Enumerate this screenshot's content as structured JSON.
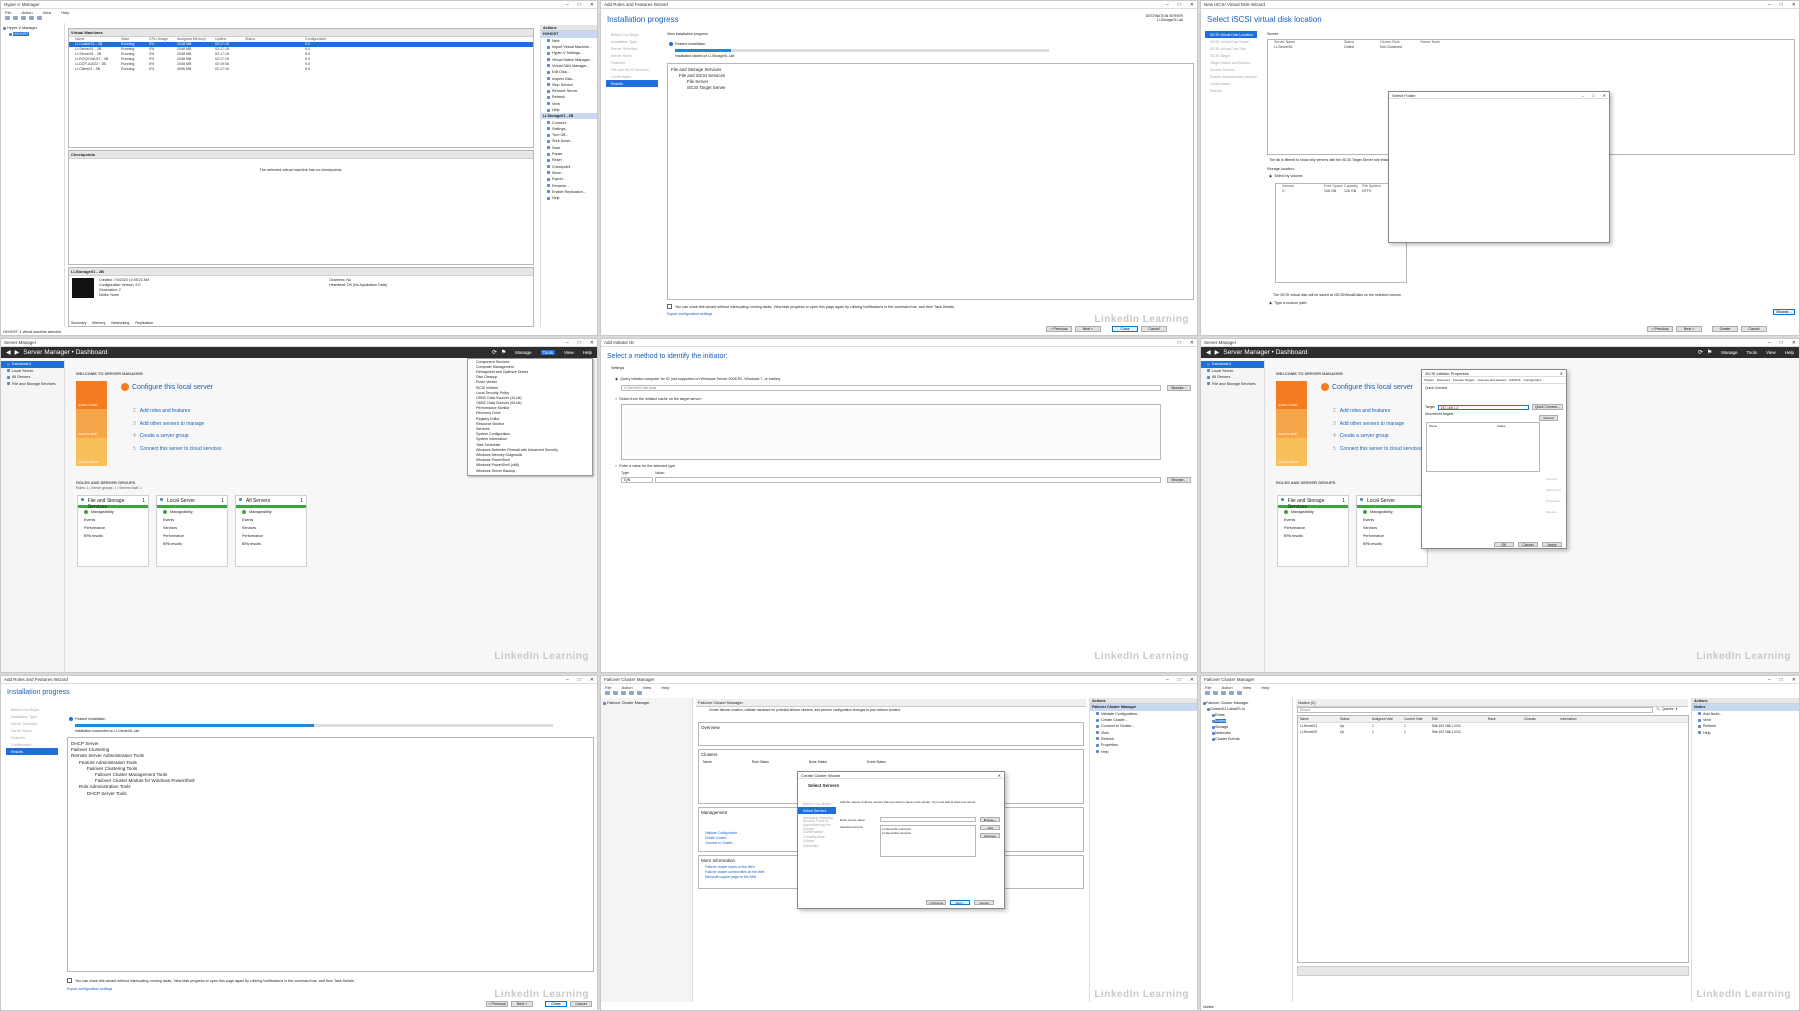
{
  "p1": {
    "title": "Hyper-V Manager",
    "menu": [
      "File",
      "Action",
      "View",
      "Help"
    ],
    "tree": [
      "Hyper-V Manager",
      "HVHOST"
    ],
    "vm_header": "Virtual Machines",
    "vm_columns": [
      "Name",
      "State",
      "CPU Usage",
      "Assigned Memory",
      "Uptime",
      "Status",
      "Configuration"
    ],
    "vms": [
      [
        "LI-Cluster01 - 2B",
        "Running",
        "0%",
        "2048 MB",
        "02:17:19",
        "",
        "9.0"
      ],
      [
        "LI-Server01 - 2B",
        "Running",
        "0%",
        "2048 MB",
        "02:17:15",
        "",
        "9.0"
      ],
      [
        "LI-Server01 - 2B",
        "Running",
        "0%",
        "2048 MB",
        "02:17:15",
        "",
        "9.0"
      ],
      [
        "LI-ROCKVAULT - 3B",
        "Running",
        "0%",
        "2048 MB",
        "02:17:19",
        "",
        "9.0"
      ],
      [
        "LI-DCP-A2022 - 2B",
        "Running",
        "0%",
        "2048 MB",
        "02:19:06",
        "",
        "9.0"
      ],
      [
        "LI-Client01 - 3B",
        "Running",
        "0%",
        "4096 MB",
        "02:17:15",
        "",
        "9.0"
      ]
    ],
    "checkpoints_header": "Checkpoints",
    "no_checkpoints": "The selected virtual machine has no checkpoints.",
    "detail_header": "LI-Storage01 - 2B",
    "details": [
      [
        "Created:",
        "7/4/2024 10:05:22 AM"
      ],
      [
        "Configuration Version:",
        "9.0"
      ],
      [
        "Generation:",
        "2"
      ],
      [
        "Notes:",
        "None"
      ]
    ],
    "details_right": [
      [
        "Clustered:",
        "No"
      ],
      [
        "Heartbeat:",
        "OK (No Application Data)"
      ]
    ],
    "detail_tabs": [
      "Summary",
      "Memory",
      "Networking",
      "Replication"
    ],
    "status": "HVHOST: 1 virtual machine selected.",
    "actions_header": "Actions",
    "actions_host": "HVHOST",
    "actions": [
      "New",
      "Import Virtual Machine...",
      "Hyper-V Settings...",
      "Virtual Switch Manager...",
      "Virtual SAN Manager...",
      "Edit Disk...",
      "Inspect Disk...",
      "Stop Service",
      "Remove Server",
      "Refresh",
      "View",
      "Help"
    ],
    "actions_vm": "LI-Storage01 - 2B",
    "actions2": [
      "Connect...",
      "Settings...",
      "Turn Off...",
      "Shut Down...",
      "Save",
      "Pause",
      "Reset",
      "Checkpoint",
      "Move...",
      "Export...",
      "Rename...",
      "Enable Replication...",
      "Help"
    ]
  },
  "p2": {
    "title": "Add Roles and Features Wizard",
    "heading": "Installation progress",
    "dest": "DESTINATION SERVER\nLI-Storage01.Lab",
    "steps": [
      "Before You Begin",
      "Installation Type",
      "Server Selection",
      "Server Roles",
      "Features",
      "File and iSCSI Services",
      "Confirmation",
      "Results"
    ],
    "view_progress": "View installation progress",
    "feature_install": "Feature installation",
    "succeeded": "Installation started on LI-Storage01.Lab",
    "items": [
      "File and Storage Services",
      "File and iSCSI Services",
      "File Server",
      "iSCSI Target Server"
    ],
    "note": "You can close this wizard without interrupting running tasks. View task progress or open this page again by clicking Notifications in the command bar, and then Task Details.",
    "export": "Export configuration settings",
    "buttons": [
      "< Previous",
      "Next >",
      "Close",
      "Cancel"
    ]
  },
  "p3": {
    "title": "New iSCSI Virtual Disk Wizard",
    "heading": "Select iSCSI virtual disk location",
    "steps": [
      "iSCSI Virtual Disk Location",
      "iSCSI Virtual Disk Name",
      "iSCSI Virtual Disk Size",
      "iSCSI Target",
      "Target Name and Access",
      "Access Servers",
      "Enable authentication service",
      "Confirmation",
      "Results"
    ],
    "server_label": "Server:",
    "columns": [
      "Server Name",
      "Status",
      "Cluster Role",
      "Owner Node"
    ],
    "server_row": [
      "LI-Server01",
      "Online",
      "Not Clustered",
      ""
    ],
    "folder_dialog": "Select Folder",
    "list_note": "The list is filtered to show only servers with the iSCSI Target Server role installed.",
    "storage_location": "Storage location:",
    "select_by_volume": "Select by volume:",
    "vol_columns": [
      "Volume",
      "Free Space",
      "Capacity",
      "File System"
    ],
    "vol_row": [
      "C:",
      "106 GB",
      "126 GB",
      "NTFS"
    ],
    "vol_note": "The iSCSI virtual disk will be saved at \\iSCSIVirtualDisks on the selected volume.",
    "custom_path": "Type a custom path:",
    "browse": "Browse...",
    "buttons": [
      "< Previous",
      "Next >",
      "Create",
      "Cancel"
    ]
  },
  "p4": {
    "title": "Server Manager",
    "header": "Server Manager • Dashboard",
    "menu": [
      "Manage",
      "Tools",
      "View",
      "Help"
    ],
    "nav": [
      "Dashboard",
      "Local Server",
      "All Servers",
      "File and Storage Services"
    ],
    "welcome": "WELCOME TO SERVER MANAGER",
    "quickstart": "QUICK START",
    "whats_new": "WHAT'S NEW",
    "learn_more": "LEARN MORE",
    "configure": "Configure this local server",
    "tasks": [
      "Add roles and features",
      "Add other servers to manage",
      "Create a server group",
      "Connect this server to cloud services"
    ],
    "roles_header": "ROLES AND SERVER GROUPS",
    "roles_sub": "Roles: 1 | Server groups: 1 | Servers total: 1",
    "tiles": [
      {
        "name": "File and Storage Services",
        "count": "1",
        "rows": [
          "Manageability",
          "Events",
          "Performance",
          "BPA results"
        ]
      },
      {
        "name": "Local Server",
        "count": "1",
        "rows": [
          "Manageability",
          "Events",
          "Services",
          "Performance",
          "BPA results"
        ]
      },
      {
        "name": "All Servers",
        "count": "1",
        "rows": [
          "Manageability",
          "Events",
          "Services",
          "Performance",
          "BPA results"
        ]
      }
    ],
    "tools_menu": [
      "Component Services",
      "Computer Management",
      "Defragment and Optimize Drives",
      "Disk Cleanup",
      "Event Viewer",
      "iSCSI Initiator",
      "Local Security Policy",
      "ODBC Data Sources (32-bit)",
      "ODBC Data Sources (64-bit)",
      "Performance Monitor",
      "Recovery Drive",
      "Registry Editor",
      "Resource Monitor",
      "Services",
      "System Configuration",
      "System Information",
      "Task Scheduler",
      "Windows Defender Firewall with Advanced Security",
      "Windows Memory Diagnostic",
      "Windows PowerShell",
      "Windows PowerShell (x86)",
      "Windows Server Backup"
    ]
  },
  "p5": {
    "title": "Add Initiator ID",
    "heading": "Select a method to identify the initiator:",
    "opt1": "Query initiator computer for ID (not supported on Windows Server 2008 R2, Windows 7, or earlier):",
    "opt1_value": "LI-Server01.lab.local",
    "browse": "Browse...",
    "opt2": "Select from the initiator cache on the target server:",
    "opt3": "Enter a value for the selected type",
    "type_label": "Type:",
    "value_label": "Value:",
    "type_value": "IQN"
  },
  "p6": {
    "title": "Server Manager",
    "header": "Server Manager • Dashboard",
    "menu": [
      "Manage",
      "Tools",
      "View",
      "Help"
    ],
    "nav": [
      "Dashboard",
      "Local Server",
      "All Servers",
      "File and Storage Services"
    ],
    "dialog_title": "iSCSI Initiator Properties",
    "dialog_tabs": [
      "Targets",
      "Discovery",
      "Favorite Targets",
      "Volumes and Devices",
      "RADIUS",
      "Configuration"
    ],
    "quick_connect": "Quick Connect",
    "target_label": "Target:",
    "target_value": "192.168.1.2",
    "quick_btn": "Quick Connect...",
    "discovered": "Discovered targets",
    "refresh": "Refresh",
    "name_col": "Name",
    "status_col": "Status",
    "buttons": [
      "OK",
      "Cancel",
      "Apply"
    ],
    "side_btns": [
      "Connect",
      "Disconnect",
      "Properties...",
      "Devices..."
    ]
  },
  "p7": {
    "title": "Add Roles and Features Wizard",
    "heading": "Installation progress",
    "steps": [
      "Before You Begin",
      "Installation Type",
      "Server Selection",
      "Server Roles",
      "Features",
      "Confirmation",
      "Results"
    ],
    "feature_install": "Feature installation",
    "succeeded": "Installation succeeded on LI-Cluster01.Lab",
    "items": [
      "DHCP Server",
      "Failover Clustering",
      "Remote Server Administration Tools",
      "Feature Administration Tools",
      "Failover Clustering Tools",
      "Failover Cluster Management Tools",
      "Failover Cluster Module for Windows PowerShell",
      "Role Administration Tools",
      "DHCP Server Tools"
    ],
    "note": "You can close this wizard without interrupting running tasks. View task progress or open this page again by clicking Notifications in the command bar, and then Task Details.",
    "export": "Export configuration settings",
    "buttons": [
      "< Previous",
      "Next >",
      "Close",
      "Cancel"
    ]
  },
  "p8": {
    "title": "Failover Cluster Manager",
    "menu": [
      "File",
      "Action",
      "View",
      "Help"
    ],
    "tree": [
      "Failover Cluster Manager"
    ],
    "center_title": "Failover Cluster Manager",
    "center_desc": "Create failover clusters, validate hardware for potential failover clusters, and perform configuration changes to your failover clusters.",
    "sections": [
      "Overview",
      "Clusters",
      "Management",
      "More Information"
    ],
    "cluster_cols": [
      "Name",
      "Role Status",
      "Node Status",
      "Event Status"
    ],
    "mgmt_links": [
      "Validate Configuration...",
      "Create Cluster...",
      "Connect to Cluster..."
    ],
    "info_links": [
      "Failover cluster topics on the Web",
      "Failover cluster communities on the Web",
      "Microsoft support page on the Web"
    ],
    "wizard_title": "Create Cluster Wizard",
    "wizard_heading": "Select Servers",
    "wizard_steps": [
      "Before You Begin",
      "Select Servers",
      "Validation Warning",
      "Access Point for Administering the Cluster",
      "Confirmation",
      "Creating New Cluster",
      "Summary"
    ],
    "wizard_desc": "Add the names of all the servers that you want to have in the cluster. You must add at least one server.",
    "enter_name": "Enter server name:",
    "selected_servers": "Selected servers:",
    "servers": [
      "LI-Server01.Lab.local",
      "LI-Server02.Lab.local"
    ],
    "browse": "Browse...",
    "add": "Add",
    "remove": "Remove",
    "wiz_buttons": [
      "< Previous",
      "Next >",
      "Cancel"
    ],
    "actions_header": "Actions",
    "actions_sub": "Failover Cluster Manager",
    "actions": [
      "Validate Configuration...",
      "Create Cluster...",
      "Connect to Cluster...",
      "View",
      "Refresh",
      "Properties",
      "Help"
    ]
  },
  "p9": {
    "title": "Failover Cluster Manager",
    "menu": [
      "File",
      "Action",
      "View",
      "Help"
    ],
    "tree": [
      "Failover Cluster Manager",
      "Cluster01.LabsDS.lo",
      "Roles",
      "Nodes",
      "Storage",
      "Networks",
      "Cluster Events"
    ],
    "nodes_header": "Nodes (2)",
    "search": "Search",
    "queries": "Queries",
    "cols": [
      "Name",
      "Status",
      "Assigned Vote",
      "Current Vote",
      "Site",
      "Rack",
      "Chassis",
      "Information"
    ],
    "rows": [
      [
        "LI-Server01",
        "Up",
        "1",
        "1",
        "Site 192.168.1.0/24",
        "",
        "",
        ""
      ],
      [
        "LI-Server02",
        "Up",
        "1",
        "1",
        "Site 192.168.1.0/24",
        "",
        "",
        ""
      ]
    ],
    "actions_header": "Actions",
    "actions_sub": "Nodes",
    "actions": [
      "Add Node...",
      "View",
      "Refresh",
      "Help"
    ],
    "status": "Nodes: "
  },
  "watermark": "LinkedIn Learning",
  "colors": {
    "accent": "#1e6fd9",
    "sm_header": "#2d2d30",
    "quickstart": "#f47b20",
    "green": "#3aa83a"
  }
}
